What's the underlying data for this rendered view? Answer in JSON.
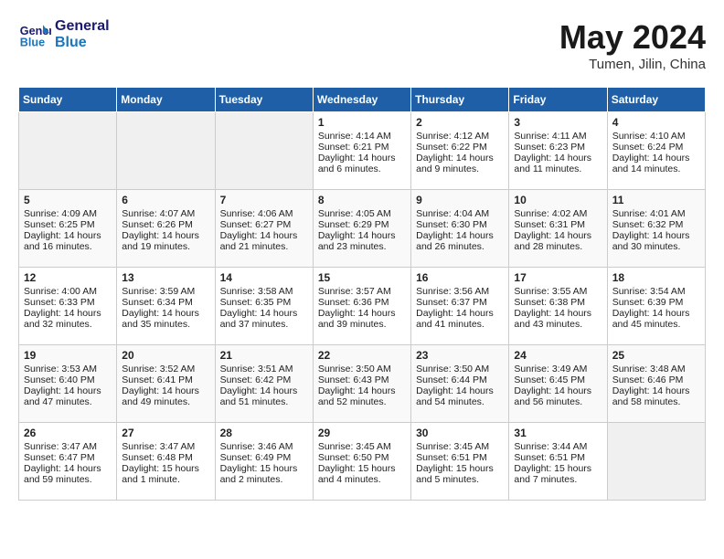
{
  "header": {
    "logo_line1": "General",
    "logo_line2": "Blue",
    "month_title": "May 2024",
    "location": "Tumen, Jilin, China"
  },
  "calendar": {
    "days_of_week": [
      "Sunday",
      "Monday",
      "Tuesday",
      "Wednesday",
      "Thursday",
      "Friday",
      "Saturday"
    ],
    "weeks": [
      [
        {
          "day": "",
          "empty": true
        },
        {
          "day": "",
          "empty": true
        },
        {
          "day": "",
          "empty": true
        },
        {
          "day": "1",
          "sunrise": "Sunrise: 4:14 AM",
          "sunset": "Sunset: 6:21 PM",
          "daylight": "Daylight: 14 hours and 6 minutes."
        },
        {
          "day": "2",
          "sunrise": "Sunrise: 4:12 AM",
          "sunset": "Sunset: 6:22 PM",
          "daylight": "Daylight: 14 hours and 9 minutes."
        },
        {
          "day": "3",
          "sunrise": "Sunrise: 4:11 AM",
          "sunset": "Sunset: 6:23 PM",
          "daylight": "Daylight: 14 hours and 11 minutes."
        },
        {
          "day": "4",
          "sunrise": "Sunrise: 4:10 AM",
          "sunset": "Sunset: 6:24 PM",
          "daylight": "Daylight: 14 hours and 14 minutes."
        }
      ],
      [
        {
          "day": "5",
          "sunrise": "Sunrise: 4:09 AM",
          "sunset": "Sunset: 6:25 PM",
          "daylight": "Daylight: 14 hours and 16 minutes."
        },
        {
          "day": "6",
          "sunrise": "Sunrise: 4:07 AM",
          "sunset": "Sunset: 6:26 PM",
          "daylight": "Daylight: 14 hours and 19 minutes."
        },
        {
          "day": "7",
          "sunrise": "Sunrise: 4:06 AM",
          "sunset": "Sunset: 6:27 PM",
          "daylight": "Daylight: 14 hours and 21 minutes."
        },
        {
          "day": "8",
          "sunrise": "Sunrise: 4:05 AM",
          "sunset": "Sunset: 6:29 PM",
          "daylight": "Daylight: 14 hours and 23 minutes."
        },
        {
          "day": "9",
          "sunrise": "Sunrise: 4:04 AM",
          "sunset": "Sunset: 6:30 PM",
          "daylight": "Daylight: 14 hours and 26 minutes."
        },
        {
          "day": "10",
          "sunrise": "Sunrise: 4:02 AM",
          "sunset": "Sunset: 6:31 PM",
          "daylight": "Daylight: 14 hours and 28 minutes."
        },
        {
          "day": "11",
          "sunrise": "Sunrise: 4:01 AM",
          "sunset": "Sunset: 6:32 PM",
          "daylight": "Daylight: 14 hours and 30 minutes."
        }
      ],
      [
        {
          "day": "12",
          "sunrise": "Sunrise: 4:00 AM",
          "sunset": "Sunset: 6:33 PM",
          "daylight": "Daylight: 14 hours and 32 minutes."
        },
        {
          "day": "13",
          "sunrise": "Sunrise: 3:59 AM",
          "sunset": "Sunset: 6:34 PM",
          "daylight": "Daylight: 14 hours and 35 minutes."
        },
        {
          "day": "14",
          "sunrise": "Sunrise: 3:58 AM",
          "sunset": "Sunset: 6:35 PM",
          "daylight": "Daylight: 14 hours and 37 minutes."
        },
        {
          "day": "15",
          "sunrise": "Sunrise: 3:57 AM",
          "sunset": "Sunset: 6:36 PM",
          "daylight": "Daylight: 14 hours and 39 minutes."
        },
        {
          "day": "16",
          "sunrise": "Sunrise: 3:56 AM",
          "sunset": "Sunset: 6:37 PM",
          "daylight": "Daylight: 14 hours and 41 minutes."
        },
        {
          "day": "17",
          "sunrise": "Sunrise: 3:55 AM",
          "sunset": "Sunset: 6:38 PM",
          "daylight": "Daylight: 14 hours and 43 minutes."
        },
        {
          "day": "18",
          "sunrise": "Sunrise: 3:54 AM",
          "sunset": "Sunset: 6:39 PM",
          "daylight": "Daylight: 14 hours and 45 minutes."
        }
      ],
      [
        {
          "day": "19",
          "sunrise": "Sunrise: 3:53 AM",
          "sunset": "Sunset: 6:40 PM",
          "daylight": "Daylight: 14 hours and 47 minutes."
        },
        {
          "day": "20",
          "sunrise": "Sunrise: 3:52 AM",
          "sunset": "Sunset: 6:41 PM",
          "daylight": "Daylight: 14 hours and 49 minutes."
        },
        {
          "day": "21",
          "sunrise": "Sunrise: 3:51 AM",
          "sunset": "Sunset: 6:42 PM",
          "daylight": "Daylight: 14 hours and 51 minutes."
        },
        {
          "day": "22",
          "sunrise": "Sunrise: 3:50 AM",
          "sunset": "Sunset: 6:43 PM",
          "daylight": "Daylight: 14 hours and 52 minutes."
        },
        {
          "day": "23",
          "sunrise": "Sunrise: 3:50 AM",
          "sunset": "Sunset: 6:44 PM",
          "daylight": "Daylight: 14 hours and 54 minutes."
        },
        {
          "day": "24",
          "sunrise": "Sunrise: 3:49 AM",
          "sunset": "Sunset: 6:45 PM",
          "daylight": "Daylight: 14 hours and 56 minutes."
        },
        {
          "day": "25",
          "sunrise": "Sunrise: 3:48 AM",
          "sunset": "Sunset: 6:46 PM",
          "daylight": "Daylight: 14 hours and 58 minutes."
        }
      ],
      [
        {
          "day": "26",
          "sunrise": "Sunrise: 3:47 AM",
          "sunset": "Sunset: 6:47 PM",
          "daylight": "Daylight: 14 hours and 59 minutes."
        },
        {
          "day": "27",
          "sunrise": "Sunrise: 3:47 AM",
          "sunset": "Sunset: 6:48 PM",
          "daylight": "Daylight: 15 hours and 1 minute."
        },
        {
          "day": "28",
          "sunrise": "Sunrise: 3:46 AM",
          "sunset": "Sunset: 6:49 PM",
          "daylight": "Daylight: 15 hours and 2 minutes."
        },
        {
          "day": "29",
          "sunrise": "Sunrise: 3:45 AM",
          "sunset": "Sunset: 6:50 PM",
          "daylight": "Daylight: 15 hours and 4 minutes."
        },
        {
          "day": "30",
          "sunrise": "Sunrise: 3:45 AM",
          "sunset": "Sunset: 6:51 PM",
          "daylight": "Daylight: 15 hours and 5 minutes."
        },
        {
          "day": "31",
          "sunrise": "Sunrise: 3:44 AM",
          "sunset": "Sunset: 6:51 PM",
          "daylight": "Daylight: 15 hours and 7 minutes."
        },
        {
          "day": "",
          "empty": true
        }
      ]
    ]
  }
}
